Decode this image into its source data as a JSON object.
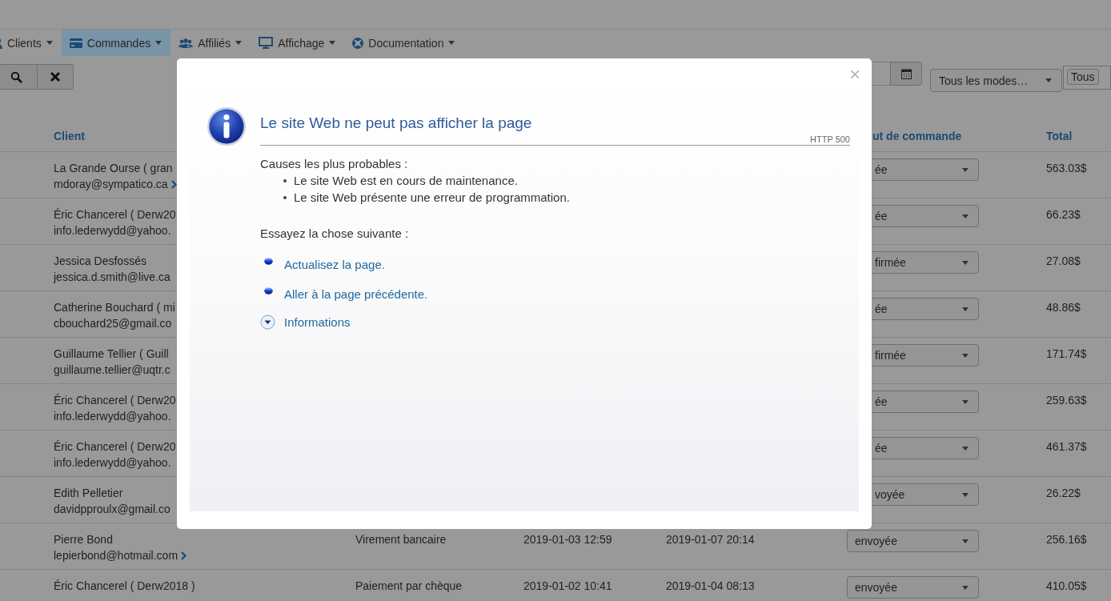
{
  "nav": [
    {
      "label": "Clients",
      "selected": false
    },
    {
      "label": "Commandes",
      "selected": true
    },
    {
      "label": "Affiliés",
      "selected": false
    },
    {
      "label": "Affichage",
      "selected": false
    },
    {
      "label": "Documentation",
      "selected": false
    }
  ],
  "toolbar": {
    "mode_select": "Tous les modes…",
    "status_select": "Tous"
  },
  "table": {
    "columns": [
      {
        "label": "Client"
      },
      {},
      {},
      {},
      {
        "label": "ut de commande"
      },
      {
        "label": "Total"
      }
    ],
    "rows": [
      {
        "client_name": "La Grande Ourse ( gran",
        "client_email": "mdoray@sympatico.ca",
        "details_arrow": true,
        "status": "ée",
        "total": "563.03$",
        "covered": true
      },
      {
        "client_name": "Éric Chancerel ( Derw20",
        "client_email": "info.lederwydd@yahoo.",
        "details_arrow": false,
        "status": "ée",
        "total": "66.23$",
        "covered": true
      },
      {
        "client_name": "Jessica Desfossés",
        "client_email": "jessica.d.smith@live.ca",
        "details_arrow": false,
        "status": "firmée",
        "total": "27.08$",
        "covered": true
      },
      {
        "client_name": "Catherine Bouchard ( mi",
        "client_email": "cbouchard25@gmail.co",
        "details_arrow": false,
        "status": "ée",
        "total": "48.86$",
        "covered": true
      },
      {
        "client_name": "Guillaume Tellier ( Guill",
        "client_email": "guillaume.tellier@uqtr.c",
        "details_arrow": false,
        "status": "firmée",
        "total": "171.74$",
        "covered": true
      },
      {
        "client_name": "Éric Chancerel ( Derw20",
        "client_email": "info.lederwydd@yahoo.",
        "details_arrow": false,
        "status": "ée",
        "total": "259.63$",
        "covered": true
      },
      {
        "client_name": "Éric Chancerel ( Derw20",
        "client_email": "info.lederwydd@yahoo.",
        "details_arrow": false,
        "status": "ée",
        "total": "461.37$",
        "covered": true
      },
      {
        "client_name": "Edith Pelletier",
        "client_email": "davidpproulx@gmail.co",
        "details_arrow": false,
        "status": "voyée",
        "total": "26.22$",
        "covered": true
      },
      {
        "client_name": "Pierre Bond",
        "client_email": "lepierbond@hotmail.com",
        "details_arrow": true,
        "payment": "Virement bancaire",
        "ordered": "2019-01-03 12:59",
        "shipped": "2019-01-07 20:14",
        "status": "envoyée",
        "total": "256.16$",
        "covered": false
      },
      {
        "client_name": "Éric Chancerel ( Derw2018 )",
        "details_arrow": false,
        "payment": "Paiement par chèque",
        "ordered": "2019-01-02 10:41",
        "shipped": "2019-01-04 08:13",
        "status": "envoyée",
        "total": "410.05$",
        "covered": false
      }
    ]
  },
  "dialog": {
    "title": "Le site Web ne peut pas afficher la page",
    "code": "HTTP 500",
    "causes_heading": "Causes les plus probables :",
    "causes": [
      "Le site Web est en cours de maintenance.",
      "Le site Web présente une erreur de programmation."
    ],
    "try_heading": "Essayez la chose suivante :",
    "actions": [
      {
        "label": "Actualisez la page.",
        "kind": "link"
      },
      {
        "label": "Aller à la page précédente.",
        "kind": "link"
      },
      {
        "label": "Informations",
        "kind": "expander"
      }
    ],
    "close": "×"
  }
}
